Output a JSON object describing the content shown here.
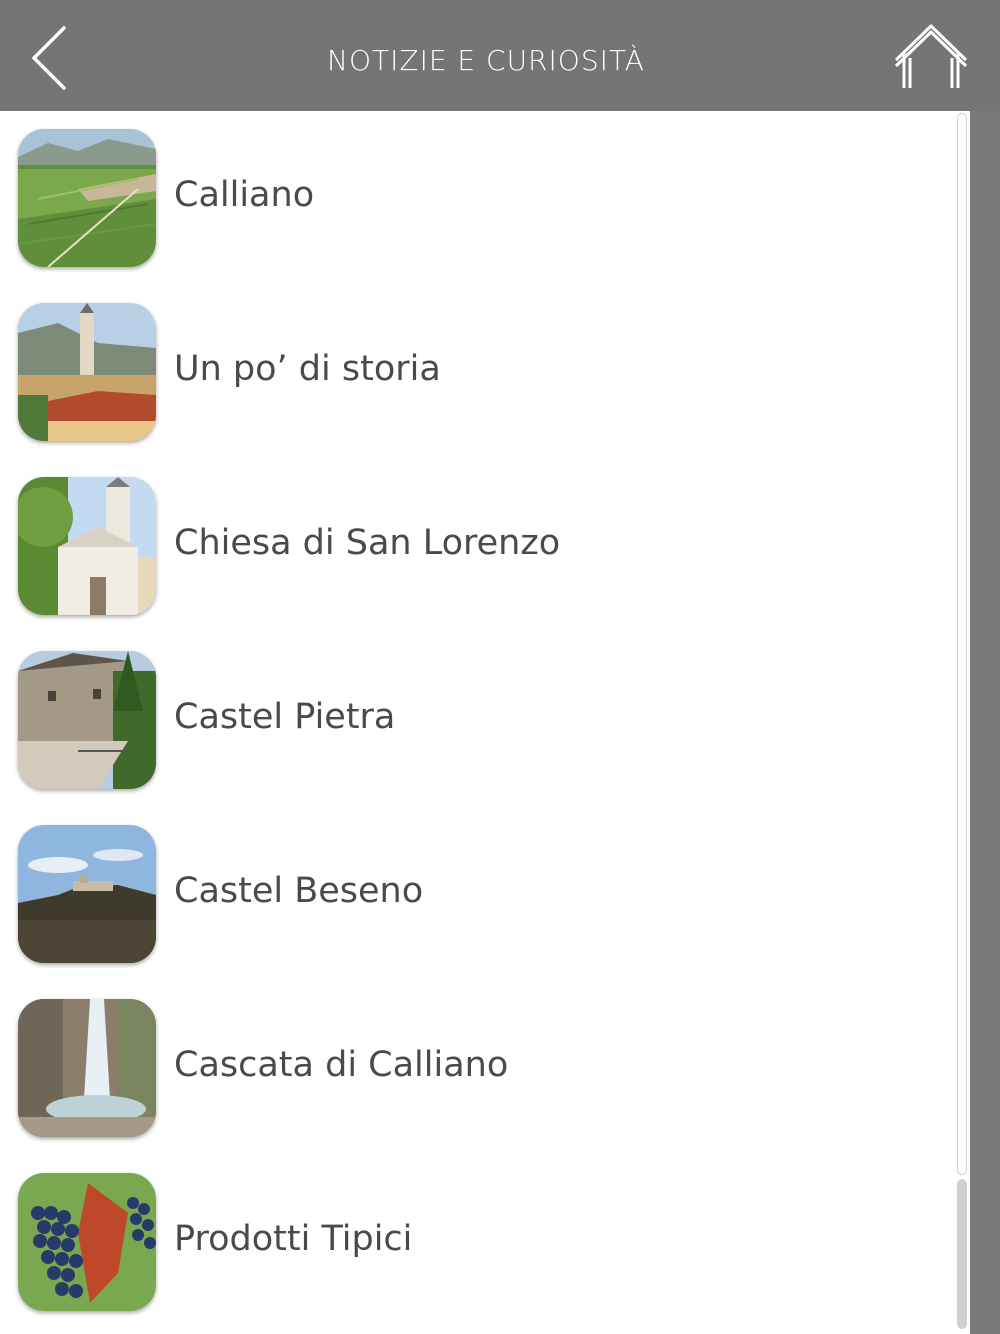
{
  "header": {
    "title": "NOTIZIE E CURIOSITÀ",
    "back_icon": "chevron-left-icon",
    "home_icon": "home-icon",
    "background_color": "#757575"
  },
  "list": {
    "items": [
      {
        "label": "Calliano",
        "thumbnail": "aerial-valley-vineyards"
      },
      {
        "label": "Un po’ di storia",
        "thumbnail": "village-bell-tower"
      },
      {
        "label": "Chiesa di San Lorenzo",
        "thumbnail": "church-facade"
      },
      {
        "label": "Castel Pietra",
        "thumbnail": "castle-stone-path"
      },
      {
        "label": "Castel Beseno",
        "thumbnail": "castle-on-hill"
      },
      {
        "label": "Cascata di Calliano",
        "thumbnail": "waterfall"
      },
      {
        "label": "Prodotti Tipici",
        "thumbnail": "grapes-vine"
      }
    ]
  },
  "colors": {
    "text": "#4a4a4a",
    "list_background": "#ffffff",
    "frame": "#7a7a7a"
  }
}
